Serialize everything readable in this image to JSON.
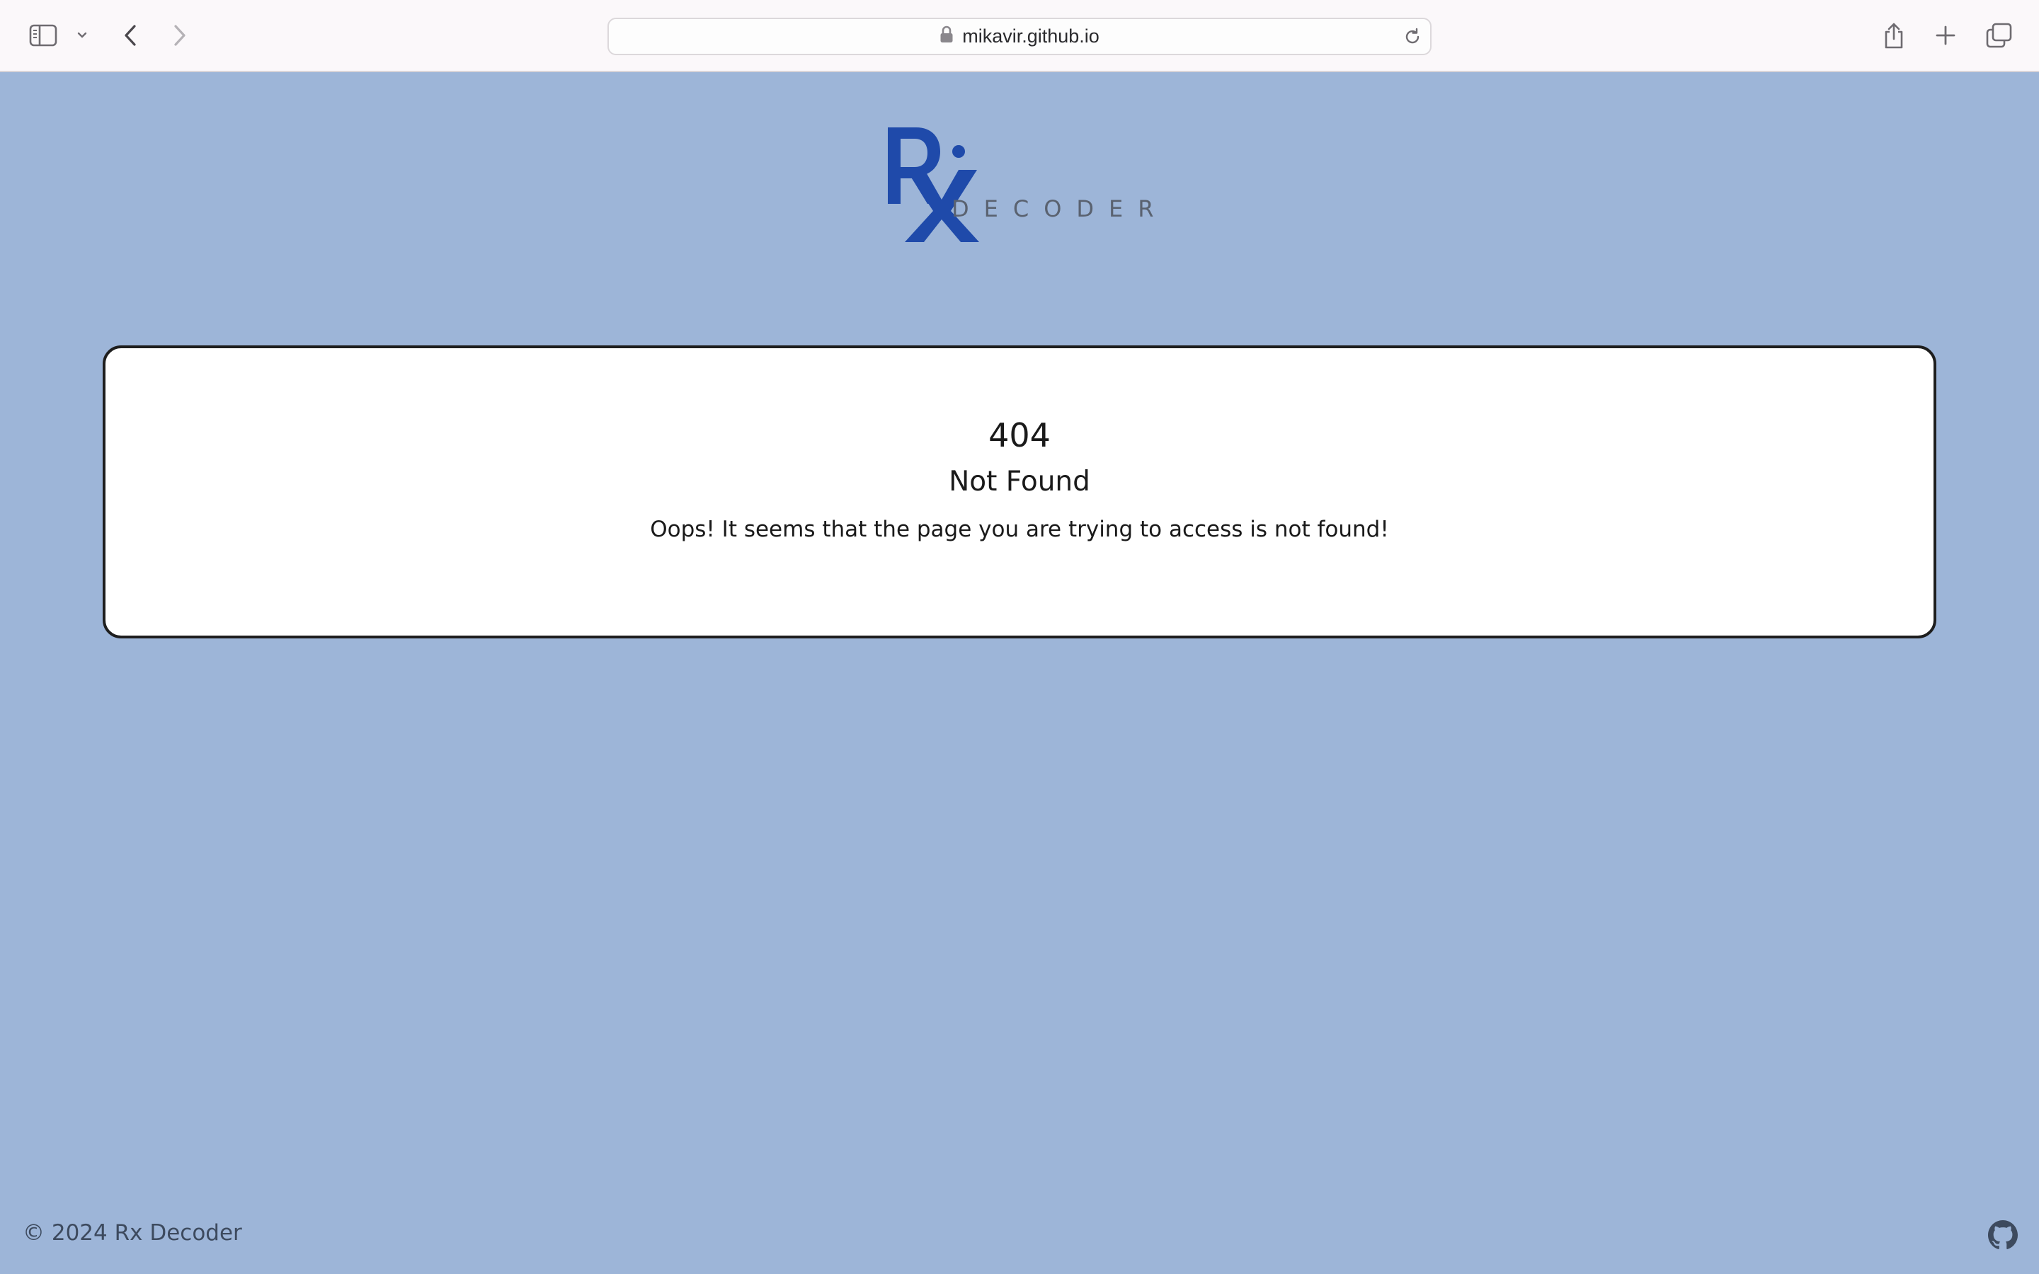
{
  "browser": {
    "url": "mikavir.github.io",
    "icons": {
      "sidebar": "sidebar-icon",
      "tab_group_menu": "chevron-down-icon",
      "back": "back-arrow-icon",
      "forward": "forward-arrow-icon",
      "lock": "lock-icon",
      "reload": "reload-icon",
      "share": "share-icon",
      "new_tab": "plus-icon",
      "tab_overview": "tabs-overview-icon"
    }
  },
  "logo": {
    "mark": "Rx",
    "wordmark": "DECODER",
    "mark_color": "#1f4aaa"
  },
  "error": {
    "code": "404",
    "title": "Not Found",
    "message": "Oops! It seems that the page you are trying to access is not found!"
  },
  "footer": {
    "copyright": "© 2024 Rx Decoder",
    "github_icon": "github-icon"
  },
  "colors": {
    "page_background": "#9db5d8",
    "card_background": "#ffffff",
    "card_border": "#1e1e1e",
    "toolbar_background": "#fbf8fa"
  }
}
